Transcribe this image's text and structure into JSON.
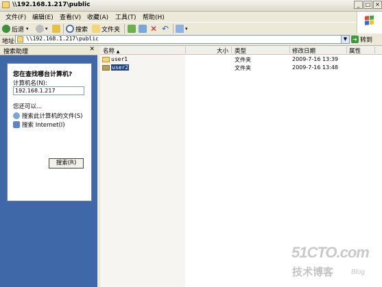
{
  "window": {
    "title": "\\\\192.168.1.217\\public"
  },
  "menu": [
    "文件(F)",
    "编辑(E)",
    "查看(V)",
    "收藏(A)",
    "工具(T)",
    "帮助(H)"
  ],
  "toolbar": {
    "back": "后退",
    "search": "搜索",
    "folders": "文件夹"
  },
  "address": {
    "label": "地址(D)",
    "value": "\\\\192.168.1.217\\public",
    "go": "转到"
  },
  "search_pane": {
    "title": "搜索助理",
    "question": "您在查找哪台计算机?",
    "name_label": "计算机名(N):",
    "name_value": "192.168.1.217",
    "more": "您还可以...",
    "link_files": "搜索此计算机的文件(S)",
    "link_internet": "搜索 Internet(I)",
    "search_button": "搜索(R)"
  },
  "columns": {
    "name": "名称",
    "size": "大小",
    "type": "类型",
    "modified": "修改日期",
    "attributes": "属性"
  },
  "files": [
    {
      "name": "user1",
      "type": "文件夹",
      "modified": "2009-7-16 13:39"
    },
    {
      "name": "user2",
      "type": "文件夹",
      "modified": "2009-7-16 13:48"
    }
  ],
  "watermark": {
    "site": "51CTO.com",
    "sub": "技术博客",
    "blog": "Blog"
  },
  "colors": {
    "pane_blue": "#3e68a8",
    "selection": "#1a3d7f"
  }
}
